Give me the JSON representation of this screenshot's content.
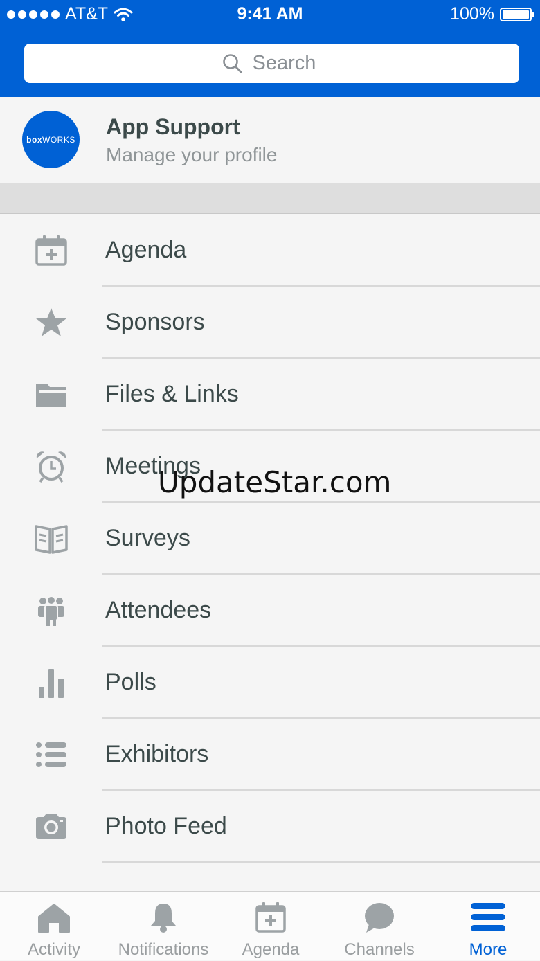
{
  "status_bar": {
    "carrier": "AT&T",
    "time": "9:41 AM",
    "battery": "100%"
  },
  "search": {
    "placeholder": "Search"
  },
  "profile": {
    "avatar_text_a": "box",
    "avatar_text_b": "WORKS",
    "name": "App Support",
    "subtitle": "Manage your profile"
  },
  "menu": {
    "items": [
      {
        "label": "Agenda",
        "icon": "calendar-add-icon"
      },
      {
        "label": "Sponsors",
        "icon": "star-icon"
      },
      {
        "label": "Files & Links",
        "icon": "folder-icon"
      },
      {
        "label": "Meetings",
        "icon": "alarm-clock-icon"
      },
      {
        "label": "Surveys",
        "icon": "open-book-icon"
      },
      {
        "label": "Attendees",
        "icon": "people-icon"
      },
      {
        "label": "Polls",
        "icon": "bar-chart-icon"
      },
      {
        "label": "Exhibitors",
        "icon": "list-icon"
      },
      {
        "label": "Photo Feed",
        "icon": "camera-icon"
      }
    ]
  },
  "watermark": "UpdateStar.com",
  "tabbar": {
    "tabs": [
      {
        "label": "Activity",
        "icon": "home-icon"
      },
      {
        "label": "Notifications",
        "icon": "bell-icon"
      },
      {
        "label": "Agenda",
        "icon": "calendar-add-icon"
      },
      {
        "label": "Channels",
        "icon": "chat-bubble-icon"
      },
      {
        "label": "More",
        "icon": "hamburger-icon",
        "active": true
      }
    ]
  },
  "colors": {
    "brand_blue": "#0061d5",
    "icon_gray": "#9da3a6",
    "text": "#3c4a4a"
  }
}
